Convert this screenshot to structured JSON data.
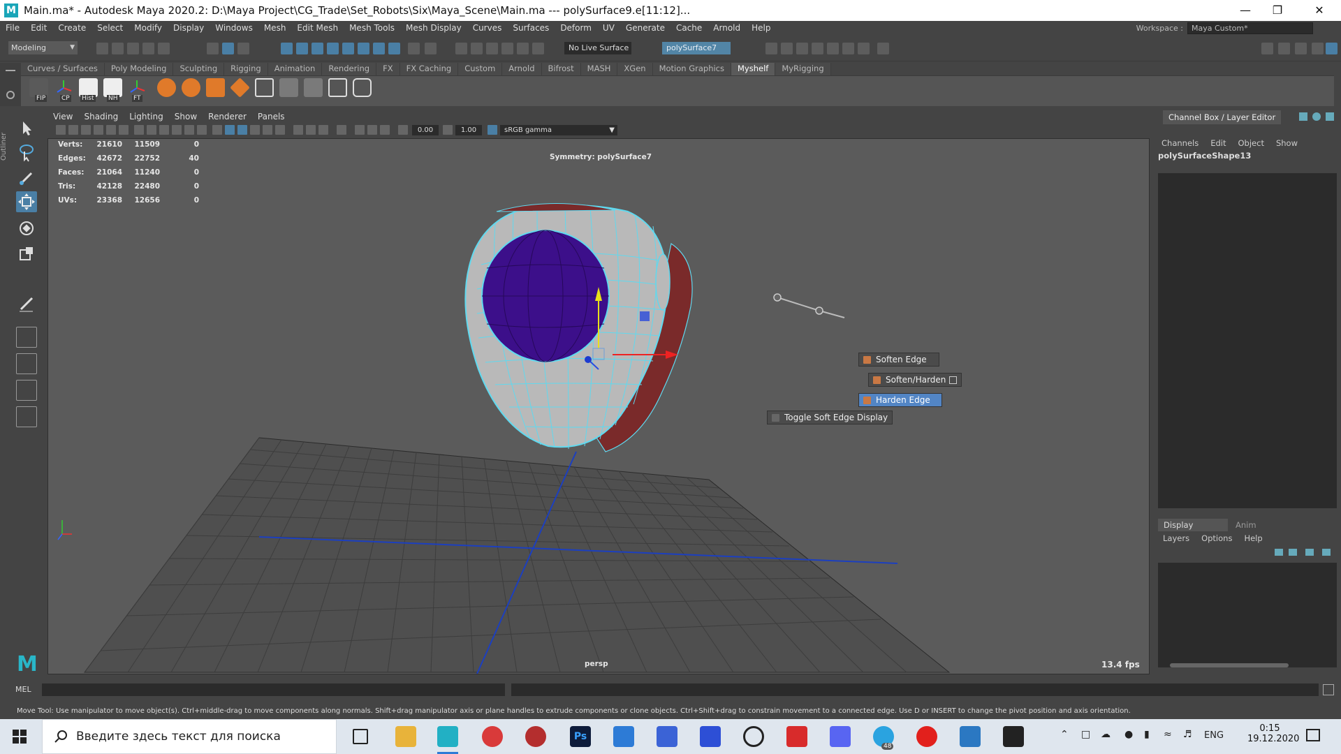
{
  "titlebar": {
    "title": "Main.ma* - Autodesk Maya 2020.2: D:\\Maya Project\\CG_Trade\\Set_Robots\\Six\\Maya_Scene\\Main.ma  ---  polySurface9.e[11:12]...",
    "logo": "M"
  },
  "menu": [
    "File",
    "Edit",
    "Create",
    "Select",
    "Modify",
    "Display",
    "Windows",
    "Mesh",
    "Edit Mesh",
    "Mesh Tools",
    "Mesh Display",
    "Curves",
    "Surfaces",
    "Deform",
    "UV",
    "Generate",
    "Cache",
    "Arnold",
    "Help"
  ],
  "workspace": {
    "label": "Workspace :",
    "value": "Maya Custom*"
  },
  "statusline": {
    "mode": "Modeling",
    "live_surface": "No Live Surface",
    "object_field": "polySurface7"
  },
  "shelf": {
    "tabs": [
      "Curves / Surfaces",
      "Poly Modeling",
      "Sculpting",
      "Rigging",
      "Animation",
      "Rendering",
      "FX",
      "FX Caching",
      "Custom",
      "Arnold",
      "Bifrost",
      "MASH",
      "XGen",
      "Motion Graphics",
      "Myshelf",
      "MyRigging"
    ],
    "active": "Myshelf",
    "icon_labels": [
      "FIP",
      "CP",
      "Hist",
      "NH",
      "FT"
    ]
  },
  "outliner_tab": "Outliner",
  "viewport": {
    "menu": [
      "View",
      "Shading",
      "Lighting",
      "Show",
      "Renderer",
      "Panels"
    ],
    "exposure": "0.00",
    "gamma": "1.00",
    "colorspace": "sRGB gamma",
    "hud_stats": [
      {
        "label": "Verts:",
        "a": "21610",
        "b": "11509",
        "c": "0"
      },
      {
        "label": "Edges:",
        "a": "42672",
        "b": "22752",
        "c": "40"
      },
      {
        "label": "Faces:",
        "a": "21064",
        "b": "11240",
        "c": "0"
      },
      {
        "label": "Tris:",
        "a": "42128",
        "b": "22480",
        "c": "0"
      },
      {
        "label": "UVs:",
        "a": "23368",
        "b": "12656",
        "c": "0"
      }
    ],
    "symmetry": "Symmetry: polySurface7",
    "camera": "persp",
    "fps": "13.4 fps"
  },
  "marking_menu": {
    "soften": "Soften Edge",
    "soften_harden": "Soften/Harden",
    "harden": "Harden Edge",
    "toggle": "Toggle Soft Edge Display"
  },
  "channel_box": {
    "title": "Channel Box / Layer Editor",
    "menu": [
      "Channels",
      "Edit",
      "Object",
      "Show"
    ],
    "shape": "polySurfaceShape13",
    "layer_tabs": [
      "Display",
      "Anim"
    ],
    "layer_menu": [
      "Layers",
      "Options",
      "Help"
    ]
  },
  "command": {
    "label": "MEL"
  },
  "help_line": "Move Tool: Use manipulator to move object(s). Ctrl+middle-drag to move components along normals. Shift+drag manipulator axis or plane handles to extrude components or clone objects. Ctrl+Shift+drag to constrain movement to a connected edge. Use D or INSERT to change the pivot position and axis orientation.",
  "taskbar": {
    "search_placeholder": "Введите здесь текст для поиска",
    "lang": "ENG",
    "time": "0:15",
    "date": "19.12.2020",
    "badge": "48"
  },
  "colors": {
    "accent": "#5285c5",
    "mesh_wire": "#5fd9ef",
    "mesh_dark": "#7a2a2a",
    "sphere": "#3c0f8a"
  }
}
